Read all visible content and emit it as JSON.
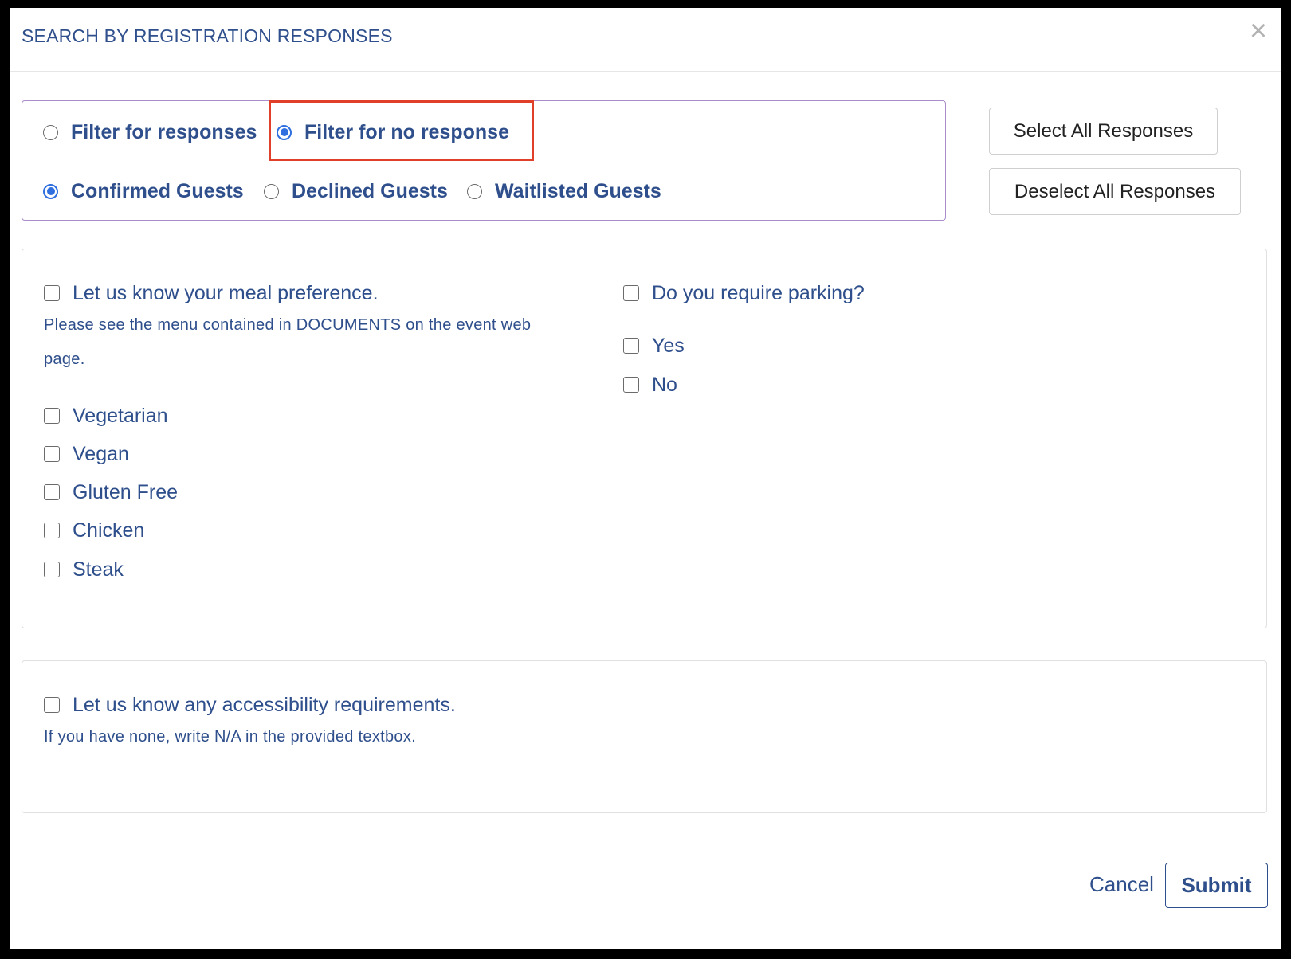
{
  "modal": {
    "title": "SEARCH BY REGISTRATION RESPONSES",
    "close_glyph": "×"
  },
  "filter_mode": {
    "options": [
      {
        "label": "Filter for responses",
        "checked": false
      },
      {
        "label": "Filter for no response",
        "checked": true
      }
    ]
  },
  "guest_status": {
    "options": [
      {
        "label": "Confirmed Guests",
        "checked": true
      },
      {
        "label": "Declined Guests",
        "checked": false
      },
      {
        "label": "Waitlisted Guests",
        "checked": false
      }
    ]
  },
  "actions": {
    "select_all": "Select All Responses",
    "deselect_all": "Deselect All Responses"
  },
  "questions": {
    "meal": {
      "label": "Let us know your meal preference.",
      "helper_line1": "Please see the menu contained in DOCUMENTS on the event web",
      "helper_line2": "page.",
      "options": [
        "Vegetarian",
        "Vegan",
        "Gluten Free",
        "Chicken",
        "Steak"
      ]
    },
    "parking": {
      "label": "Do you require parking?",
      "options": [
        "Yes",
        "No"
      ]
    },
    "accessibility": {
      "label": "Let us know any accessibility requirements.",
      "helper": "If you have none, write N/A in the provided textbox."
    }
  },
  "footer": {
    "cancel": "Cancel",
    "submit": "Submit"
  },
  "colors": {
    "text_primary": "#2e4f8c",
    "radio_selected": "#2f6fdf",
    "highlight": "#e0402a",
    "filter_border": "#a98cc9"
  }
}
